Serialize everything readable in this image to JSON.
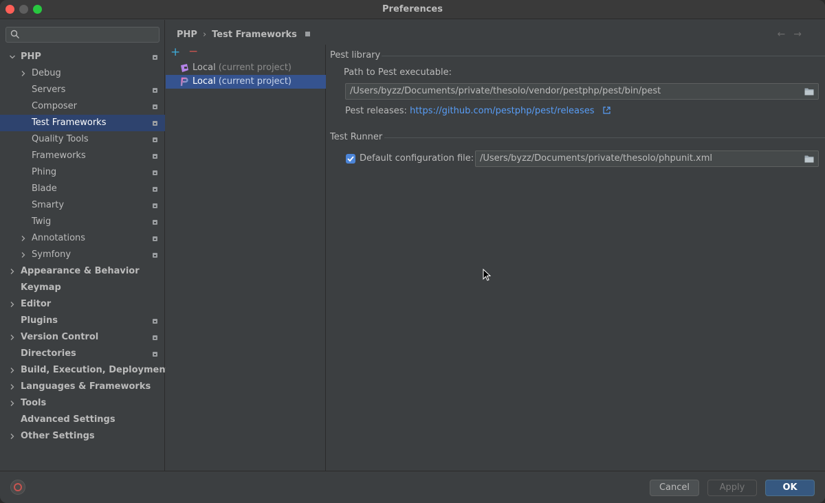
{
  "window": {
    "title": "Preferences"
  },
  "sidebar": {
    "search_placeholder": "",
    "items": [
      {
        "label": "PHP",
        "level": 0,
        "bold": true,
        "expanded": true,
        "chevron": "down",
        "project_badge": true
      },
      {
        "label": "Debug",
        "level": 1,
        "chevron": "right",
        "project_badge": false
      },
      {
        "label": "Servers",
        "level": 1,
        "project_badge": true
      },
      {
        "label": "Composer",
        "level": 1,
        "project_badge": true
      },
      {
        "label": "Test Frameworks",
        "level": 1,
        "selected": true,
        "project_badge": true
      },
      {
        "label": "Quality Tools",
        "level": 1,
        "project_badge": true
      },
      {
        "label": "Frameworks",
        "level": 1,
        "project_badge": true
      },
      {
        "label": "Phing",
        "level": 1,
        "project_badge": true
      },
      {
        "label": "Blade",
        "level": 1,
        "project_badge": true
      },
      {
        "label": "Smarty",
        "level": 1,
        "project_badge": true
      },
      {
        "label": "Twig",
        "level": 1,
        "project_badge": true
      },
      {
        "label": "Annotations",
        "level": 1,
        "chevron": "right",
        "project_badge": true
      },
      {
        "label": "Symfony",
        "level": 1,
        "chevron": "right",
        "project_badge": true
      },
      {
        "label": "Appearance & Behavior",
        "level": 0,
        "bold": true,
        "chevron": "right"
      },
      {
        "label": "Keymap",
        "level": 0,
        "bold": true
      },
      {
        "label": "Editor",
        "level": 0,
        "bold": true,
        "chevron": "right"
      },
      {
        "label": "Plugins",
        "level": 0,
        "bold": true,
        "project_badge": true
      },
      {
        "label": "Version Control",
        "level": 0,
        "bold": true,
        "chevron": "right",
        "project_badge": true
      },
      {
        "label": "Directories",
        "level": 0,
        "bold": true,
        "project_badge": true
      },
      {
        "label": "Build, Execution, Deployment",
        "level": 0,
        "bold": true,
        "chevron": "right"
      },
      {
        "label": "Languages & Frameworks",
        "level": 0,
        "bold": true,
        "chevron": "right"
      },
      {
        "label": "Tools",
        "level": 0,
        "bold": true,
        "chevron": "right"
      },
      {
        "label": "Advanced Settings",
        "level": 0,
        "bold": true
      },
      {
        "label": "Other Settings",
        "level": 0,
        "bold": true,
        "chevron": "right"
      }
    ]
  },
  "breadcrumb": {
    "parent": "PHP",
    "current": "Test Frameworks"
  },
  "configs": {
    "add_label": "+",
    "remove_label": "−",
    "items": [
      {
        "name": "Local",
        "suffix": "(current project)",
        "icon": "phpunit-icon",
        "selected": false
      },
      {
        "name": "Local",
        "suffix": "(current project)",
        "icon": "pest-icon",
        "selected": true
      }
    ]
  },
  "pest": {
    "section_title": "Pest library",
    "path_label": "Path to Pest executable:",
    "path_value": "/Users/byzz/Documents/private/thesolo/vendor/pestphp/pest/bin/pest",
    "releases_label": "Pest releases:",
    "releases_link": "https://github.com/pestphp/pest/releases"
  },
  "runner": {
    "section_title": "Test Runner",
    "default_config_label": "Default configuration file:",
    "default_config_checked": true,
    "default_config_value": "/Users/byzz/Documents/private/thesolo/phpunit.xml"
  },
  "buttons": {
    "cancel": "Cancel",
    "apply": "Apply",
    "ok": "OK"
  },
  "colors": {
    "background": "#3c3f41",
    "selection_tree": "#2e436e",
    "selection_list": "#35538f",
    "link": "#589df6",
    "add": "#3fa9d6",
    "remove": "#c75450",
    "ok_button": "#365880"
  }
}
